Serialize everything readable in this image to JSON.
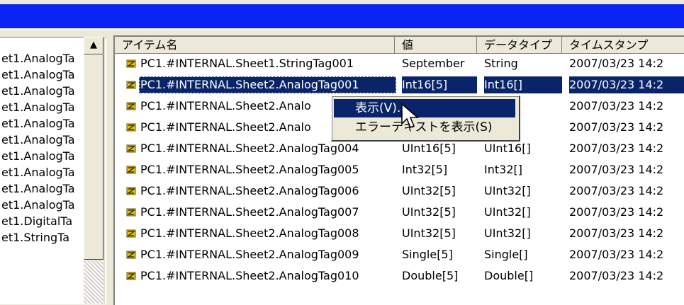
{
  "left_tree": {
    "items": [
      "et1.AnalogTa",
      "et1.AnalogTa",
      "et1.AnalogTa",
      "et1.AnalogTa",
      "et1.AnalogTa",
      "et1.AnalogTa",
      "et1.AnalogTa",
      "et1.AnalogTa",
      "et1.AnalogTa",
      "et1.AnalogTa",
      "et1.DigitalTa",
      "et1.StringTa"
    ],
    "scroll_up_icon": "▲"
  },
  "list": {
    "columns": [
      "アイテム名",
      "値",
      "データタイプ",
      "タイムスタンプ"
    ],
    "rows": [
      {
        "name": "PC1.#INTERNAL.Sheet1.StringTag001",
        "value": "September",
        "type": "String",
        "timestamp": "2007/03/23 14:2"
      },
      {
        "name": "PC1.#INTERNAL.Sheet2.AnalogTag001",
        "value": "Int16[5]",
        "type": "Int16[]",
        "timestamp": "2007/03/23 14:2",
        "selected": true
      },
      {
        "name": "PC1.#INTERNAL.Sheet2.Analo",
        "value": "",
        "type": "6[]",
        "timestamp": "2007/03/23 14:2"
      },
      {
        "name": "PC1.#INTERNAL.Sheet2.Analo",
        "value": "",
        "type": "6[]",
        "timestamp": "2007/03/23 14:2"
      },
      {
        "name": "PC1.#INTERNAL.Sheet2.AnalogTag004",
        "value": "UInt16[5]",
        "type": "UInt16[]",
        "timestamp": "2007/03/23 14:2"
      },
      {
        "name": "PC1.#INTERNAL.Sheet2.AnalogTag005",
        "value": "Int32[5]",
        "type": "Int32[]",
        "timestamp": "2007/03/23 14:2"
      },
      {
        "name": "PC1.#INTERNAL.Sheet2.AnalogTag006",
        "value": "UInt32[5]",
        "type": "UInt32[]",
        "timestamp": "2007/03/23 14:2"
      },
      {
        "name": "PC1.#INTERNAL.Sheet2.AnalogTag007",
        "value": "UInt32[5]",
        "type": "UInt32[]",
        "timestamp": "2007/03/23 14:2"
      },
      {
        "name": "PC1.#INTERNAL.Sheet2.AnalogTag008",
        "value": "UInt32[5]",
        "type": "UInt32[]",
        "timestamp": "2007/03/23 14:2"
      },
      {
        "name": "PC1.#INTERNAL.Sheet2.AnalogTag009",
        "value": "Single[5]",
        "type": "Single[]",
        "timestamp": "2007/03/23 14:2"
      },
      {
        "name": "PC1.#INTERNAL.Sheet2.AnalogTag010",
        "value": "Double[5]",
        "type": "Double[]",
        "timestamp": "2007/03/23 14:2"
      }
    ]
  },
  "context_menu": {
    "items": [
      "表示(V)...",
      "エラーテキストを表示(S)"
    ]
  },
  "colors": {
    "title_blue": "#0a24f2",
    "selection": "#0a246a",
    "face": "#ece9d8"
  },
  "icons": {
    "tag": "tag-icon",
    "cursor": "mouse-cursor-icon"
  }
}
